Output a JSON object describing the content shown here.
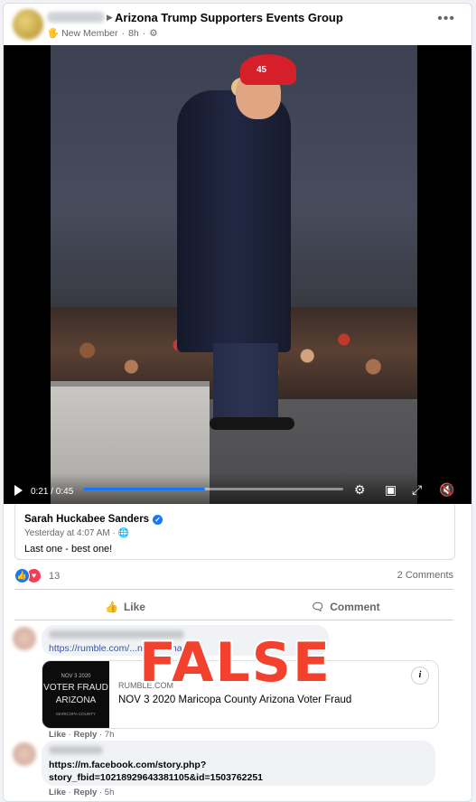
{
  "post": {
    "group_name": "Arizona Trump Supporters Events Group",
    "badge": "New Member",
    "time": "8h",
    "separator": "·",
    "more_label": "•••"
  },
  "video": {
    "hat_text": "45",
    "current_time": "0:21",
    "duration": "0:45",
    "time_display": "0:21 / 0:45",
    "progress": 0.47,
    "accent": "#1877f2"
  },
  "shared_post": {
    "author": "Sarah Huckabee Sanders",
    "verified": true,
    "timestamp": "Yesterday at 4:07 AM ·",
    "text": "Last one - best one!"
  },
  "reactions": {
    "count": "13",
    "comments_label": "2 Comments",
    "like_icon": "thumbs-up",
    "love_icon": "heart"
  },
  "actions": {
    "like_label": "Like",
    "comment_label": "Comment"
  },
  "comments": [
    {
      "link_text": "https://rumble.com/...n...20...maric...",
      "card": {
        "domain": "RUMBLE.COM",
        "title": "NOV 3 2020 Maricopa County Arizona Voter Fraud",
        "thumb_line1": "NOV 3 2020",
        "thumb_line2": "VOTER FRAUD",
        "thumb_line3": "ARIZONA",
        "thumb_line4": "MARICOPA COUNTY"
      },
      "like": "Like",
      "reply": "Reply",
      "time": "7h"
    },
    {
      "link_line1": "https://m.facebook.com/story.php?",
      "link_line2": "story_fbid=10218929643381105&id=1503762251",
      "like": "Like",
      "reply": "Reply",
      "time": "5h"
    }
  ],
  "overlay": {
    "stamp_text": "FALSE",
    "stamp_color": "#f2412d"
  }
}
